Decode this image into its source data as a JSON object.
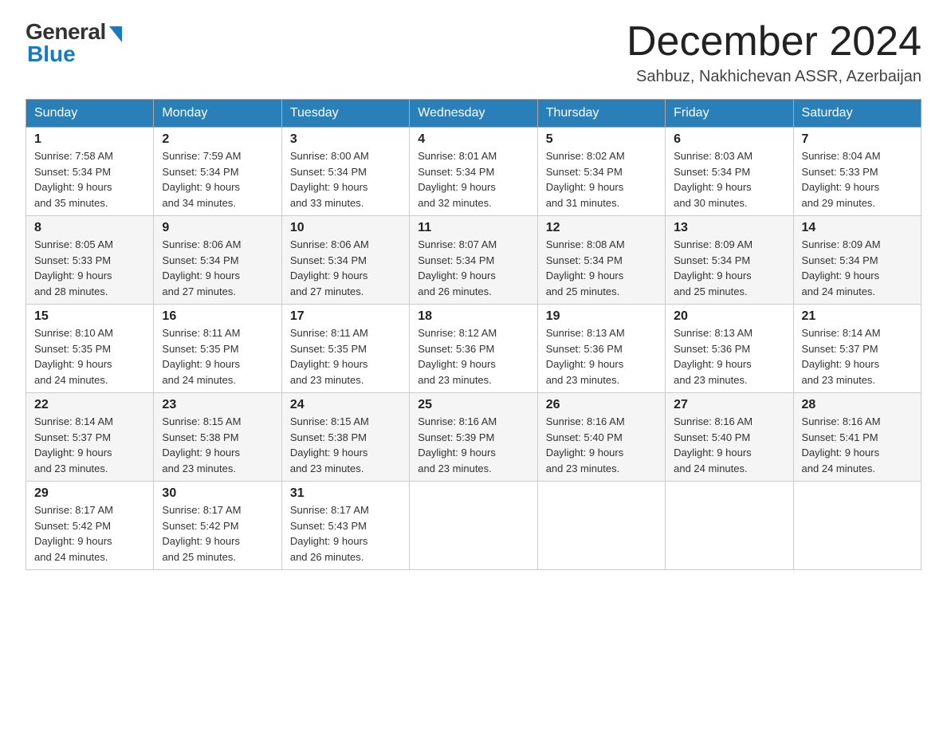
{
  "logo": {
    "general": "General",
    "blue": "Blue"
  },
  "header": {
    "month": "December 2024",
    "location": "Sahbuz, Nakhichevan ASSR, Azerbaijan"
  },
  "weekdays": [
    "Sunday",
    "Monday",
    "Tuesday",
    "Wednesday",
    "Thursday",
    "Friday",
    "Saturday"
  ],
  "weeks": [
    [
      {
        "day": "1",
        "sunrise": "7:58 AM",
        "sunset": "5:34 PM",
        "daylight": "9 hours and 35 minutes."
      },
      {
        "day": "2",
        "sunrise": "7:59 AM",
        "sunset": "5:34 PM",
        "daylight": "9 hours and 34 minutes."
      },
      {
        "day": "3",
        "sunrise": "8:00 AM",
        "sunset": "5:34 PM",
        "daylight": "9 hours and 33 minutes."
      },
      {
        "day": "4",
        "sunrise": "8:01 AM",
        "sunset": "5:34 PM",
        "daylight": "9 hours and 32 minutes."
      },
      {
        "day": "5",
        "sunrise": "8:02 AM",
        "sunset": "5:34 PM",
        "daylight": "9 hours and 31 minutes."
      },
      {
        "day": "6",
        "sunrise": "8:03 AM",
        "sunset": "5:34 PM",
        "daylight": "9 hours and 30 minutes."
      },
      {
        "day": "7",
        "sunrise": "8:04 AM",
        "sunset": "5:33 PM",
        "daylight": "9 hours and 29 minutes."
      }
    ],
    [
      {
        "day": "8",
        "sunrise": "8:05 AM",
        "sunset": "5:33 PM",
        "daylight": "9 hours and 28 minutes."
      },
      {
        "day": "9",
        "sunrise": "8:06 AM",
        "sunset": "5:34 PM",
        "daylight": "9 hours and 27 minutes."
      },
      {
        "day": "10",
        "sunrise": "8:06 AM",
        "sunset": "5:34 PM",
        "daylight": "9 hours and 27 minutes."
      },
      {
        "day": "11",
        "sunrise": "8:07 AM",
        "sunset": "5:34 PM",
        "daylight": "9 hours and 26 minutes."
      },
      {
        "day": "12",
        "sunrise": "8:08 AM",
        "sunset": "5:34 PM",
        "daylight": "9 hours and 25 minutes."
      },
      {
        "day": "13",
        "sunrise": "8:09 AM",
        "sunset": "5:34 PM",
        "daylight": "9 hours and 25 minutes."
      },
      {
        "day": "14",
        "sunrise": "8:09 AM",
        "sunset": "5:34 PM",
        "daylight": "9 hours and 24 minutes."
      }
    ],
    [
      {
        "day": "15",
        "sunrise": "8:10 AM",
        "sunset": "5:35 PM",
        "daylight": "9 hours and 24 minutes."
      },
      {
        "day": "16",
        "sunrise": "8:11 AM",
        "sunset": "5:35 PM",
        "daylight": "9 hours and 24 minutes."
      },
      {
        "day": "17",
        "sunrise": "8:11 AM",
        "sunset": "5:35 PM",
        "daylight": "9 hours and 23 minutes."
      },
      {
        "day": "18",
        "sunrise": "8:12 AM",
        "sunset": "5:36 PM",
        "daylight": "9 hours and 23 minutes."
      },
      {
        "day": "19",
        "sunrise": "8:13 AM",
        "sunset": "5:36 PM",
        "daylight": "9 hours and 23 minutes."
      },
      {
        "day": "20",
        "sunrise": "8:13 AM",
        "sunset": "5:36 PM",
        "daylight": "9 hours and 23 minutes."
      },
      {
        "day": "21",
        "sunrise": "8:14 AM",
        "sunset": "5:37 PM",
        "daylight": "9 hours and 23 minutes."
      }
    ],
    [
      {
        "day": "22",
        "sunrise": "8:14 AM",
        "sunset": "5:37 PM",
        "daylight": "9 hours and 23 minutes."
      },
      {
        "day": "23",
        "sunrise": "8:15 AM",
        "sunset": "5:38 PM",
        "daylight": "9 hours and 23 minutes."
      },
      {
        "day": "24",
        "sunrise": "8:15 AM",
        "sunset": "5:38 PM",
        "daylight": "9 hours and 23 minutes."
      },
      {
        "day": "25",
        "sunrise": "8:16 AM",
        "sunset": "5:39 PM",
        "daylight": "9 hours and 23 minutes."
      },
      {
        "day": "26",
        "sunrise": "8:16 AM",
        "sunset": "5:40 PM",
        "daylight": "9 hours and 23 minutes."
      },
      {
        "day": "27",
        "sunrise": "8:16 AM",
        "sunset": "5:40 PM",
        "daylight": "9 hours and 24 minutes."
      },
      {
        "day": "28",
        "sunrise": "8:16 AM",
        "sunset": "5:41 PM",
        "daylight": "9 hours and 24 minutes."
      }
    ],
    [
      {
        "day": "29",
        "sunrise": "8:17 AM",
        "sunset": "5:42 PM",
        "daylight": "9 hours and 24 minutes."
      },
      {
        "day": "30",
        "sunrise": "8:17 AM",
        "sunset": "5:42 PM",
        "daylight": "9 hours and 25 minutes."
      },
      {
        "day": "31",
        "sunrise": "8:17 AM",
        "sunset": "5:43 PM",
        "daylight": "9 hours and 26 minutes."
      },
      null,
      null,
      null,
      null
    ]
  ],
  "labels": {
    "sunrise": "Sunrise:",
    "sunset": "Sunset:",
    "daylight": "Daylight:"
  }
}
